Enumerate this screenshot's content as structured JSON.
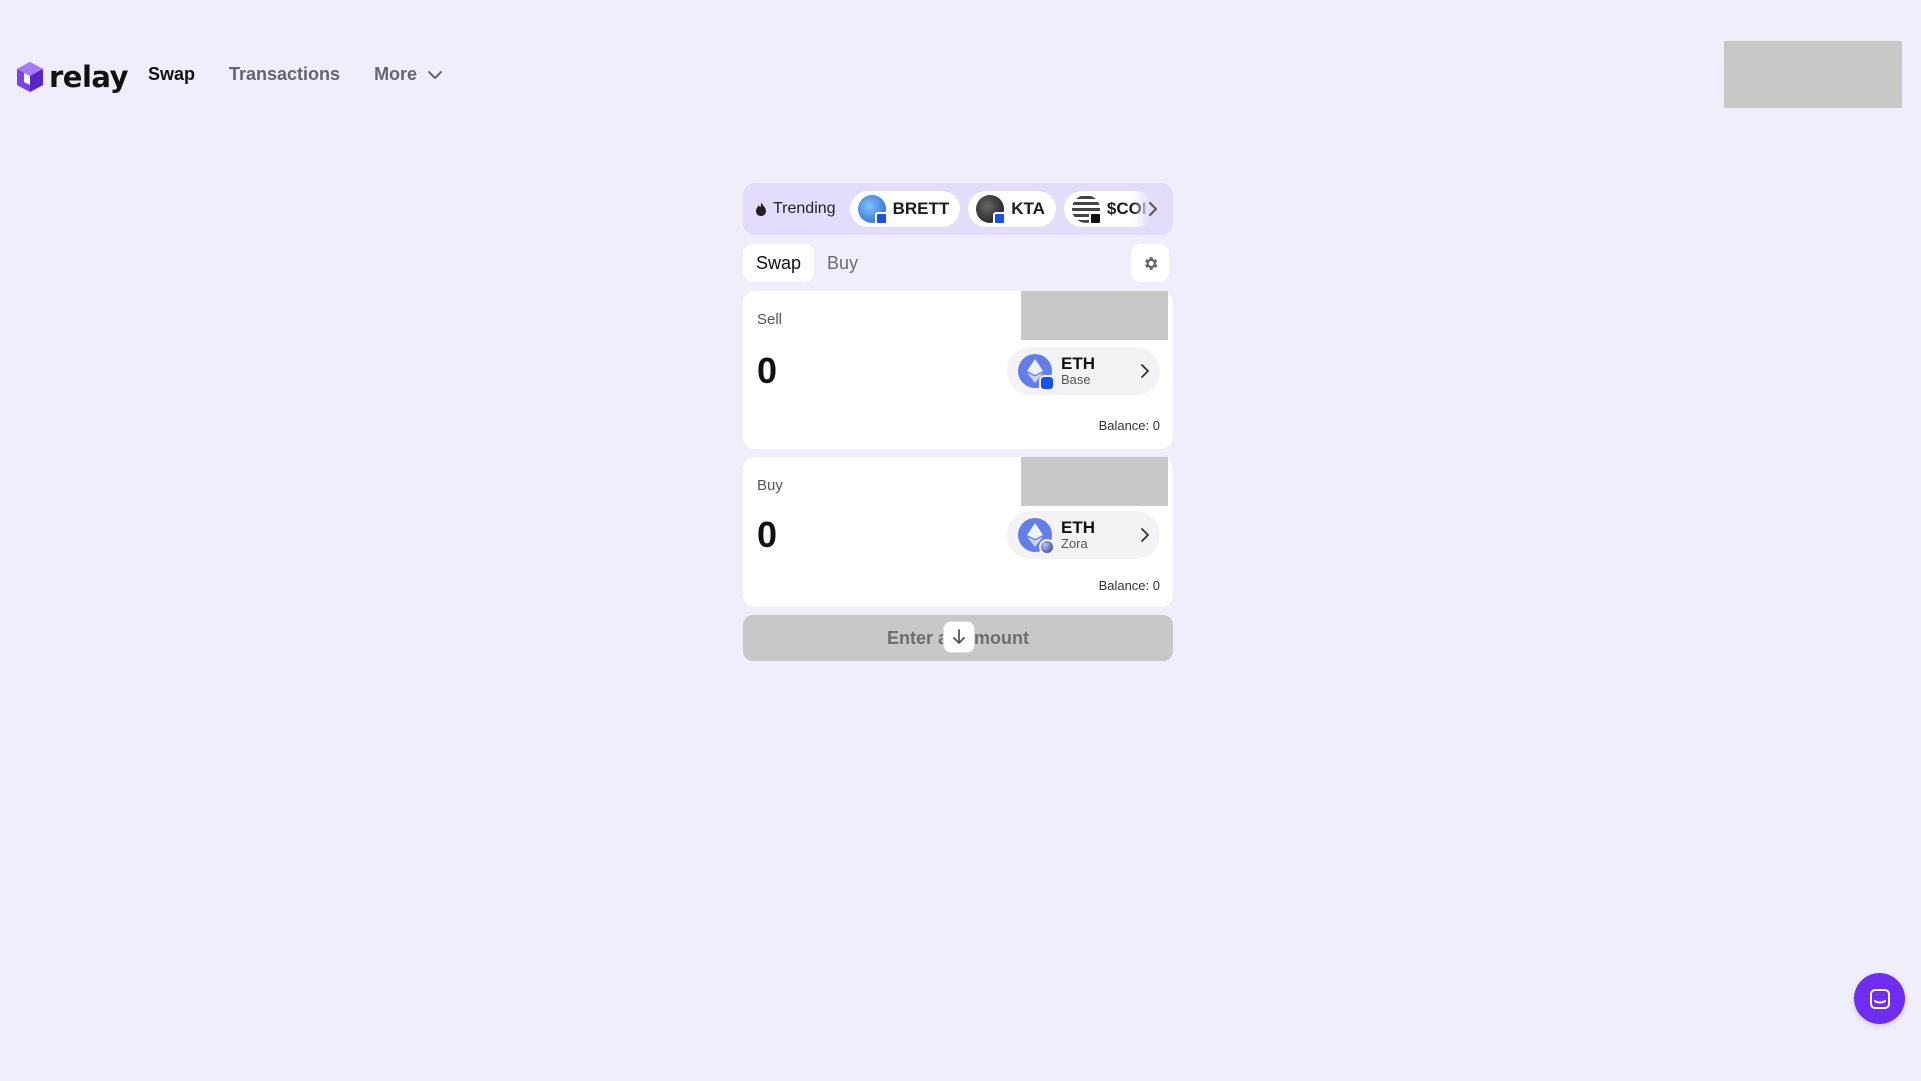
{
  "header": {
    "logo_text": "relay",
    "nav": [
      {
        "label": "Swap",
        "active": true
      },
      {
        "label": "Transactions",
        "active": false
      },
      {
        "label": "More",
        "active": false,
        "has_dropdown": true
      }
    ]
  },
  "trending": {
    "label": "Trending",
    "tokens": [
      {
        "symbol": "BRETT",
        "icon_color": "#2a6fdb",
        "badge_color": "#1652f0"
      },
      {
        "symbol": "KTA",
        "icon_color": "#222222",
        "badge_color": "#1652f0"
      },
      {
        "symbol": "$COI",
        "icon_color": "#444444",
        "badge_color": "#111111"
      }
    ]
  },
  "tabs": [
    {
      "label": "Swap",
      "active": true
    },
    {
      "label": "Buy",
      "active": false
    }
  ],
  "sell": {
    "label": "Sell",
    "amount": "0",
    "token": {
      "symbol": "ETH",
      "chain": "Base",
      "chain_color": "#1652f0"
    },
    "balance": "Balance: 0"
  },
  "buy": {
    "label": "Buy",
    "amount": "0",
    "token": {
      "symbol": "ETH",
      "chain": "Zora",
      "chain_color": "#3b3b8f"
    },
    "balance": "Balance: 0"
  },
  "cta_label": "Enter an amount",
  "colors": {
    "background": "#f1eefc",
    "brand_purple": "#6e2df0",
    "trending_bg": "#e3dcfb",
    "eth_blue": "#627eea"
  },
  "icons": [
    "relay-logo-icon",
    "chevron-down-icon",
    "flame-icon",
    "chevron-right-icon",
    "gear-icon",
    "arrow-down-icon",
    "chat-icon"
  ]
}
